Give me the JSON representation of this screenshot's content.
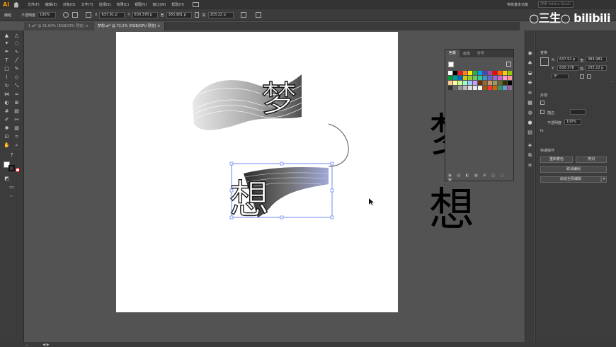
{
  "app": {
    "logo": "Ai",
    "menus": [
      "文件(F)",
      "编辑(E)",
      "对象(O)",
      "文字(T)",
      "选择(S)",
      "效果(C)",
      "视图(V)",
      "窗口(W)",
      "帮助(H)"
    ],
    "workspace": "传统基本功能",
    "search_placeholder": "搜索 Adobe Stock"
  },
  "control_bar": {
    "selection_label": "编组",
    "opacity_label": "不透明度",
    "opacity_value": "100%",
    "x_value": "637.91 p",
    "y_value": "630.378 p",
    "w_value": "383.981 p",
    "h_value": "203.22 p"
  },
  "tabs": [
    {
      "label": "1.ai* @ 31.64% (RGB/GPU 预览)",
      "active": false
    },
    {
      "label": "梦想.ai* @ 72.2% (RGB/GPU 预览)",
      "active": true
    }
  ],
  "canvas": {
    "char_top": "梦",
    "char_bottom": "想",
    "side_char_top": "梦",
    "side_char_bottom": "想"
  },
  "swatches_panel": {
    "tabs": [
      "色板",
      "画笔",
      "符号"
    ],
    "colors": [
      "#ffffff",
      "#000000",
      "#ed1c24",
      "#ff7f27",
      "#fff200",
      "#22b14c",
      "#00a2e8",
      "#3f48cc",
      "#a349a4",
      "#ff0000",
      "#ff6600",
      "#ffcc00",
      "#99cc00",
      "#009933",
      "#009999",
      "#0066cc",
      "#cccc00",
      "#99cc33",
      "#66cc66",
      "#33cc99",
      "#3399cc",
      "#6666cc",
      "#9966cc",
      "#cc66cc",
      "#ff99cc",
      "#ff9999",
      "#ffcc99",
      "#ffff99",
      "#ccff99",
      "#99ffcc",
      "#99ccff",
      "#cc99ff",
      "#663300",
      "#996633",
      "#cc9966",
      "#999966",
      "#666633",
      "#333300",
      "#000000",
      "#333333",
      "#666666",
      "#999999",
      "#bbbbbb",
      "#dddddd",
      "#e8e8e8",
      "#f4f4f4",
      "#aa5500",
      "#ff3333",
      "#cc6600",
      "#339966",
      "#6699cc",
      "#996699"
    ]
  },
  "right_panel": {
    "section_transform": "变换",
    "x_label": "X:",
    "x_value": "637.91 p",
    "y_label": "Y:",
    "y_value": "630.378",
    "w_label": "宽:",
    "w_value": "383.981",
    "h_label": "高:",
    "h_value": "203.22 p",
    "angle_value": "0°",
    "section_appearance": "外观",
    "stroke_label": "描边",
    "opacity_label": "不透明度",
    "opacity_value": "100%",
    "fx_label": "fx",
    "section_quick": "快速操作",
    "btn_reset": "重新着色",
    "btn_align": "排列",
    "btn_ungroup": "取消编组",
    "btn_isolate": "启动全局编辑"
  },
  "watermark": "○三生○ bilibili"
}
